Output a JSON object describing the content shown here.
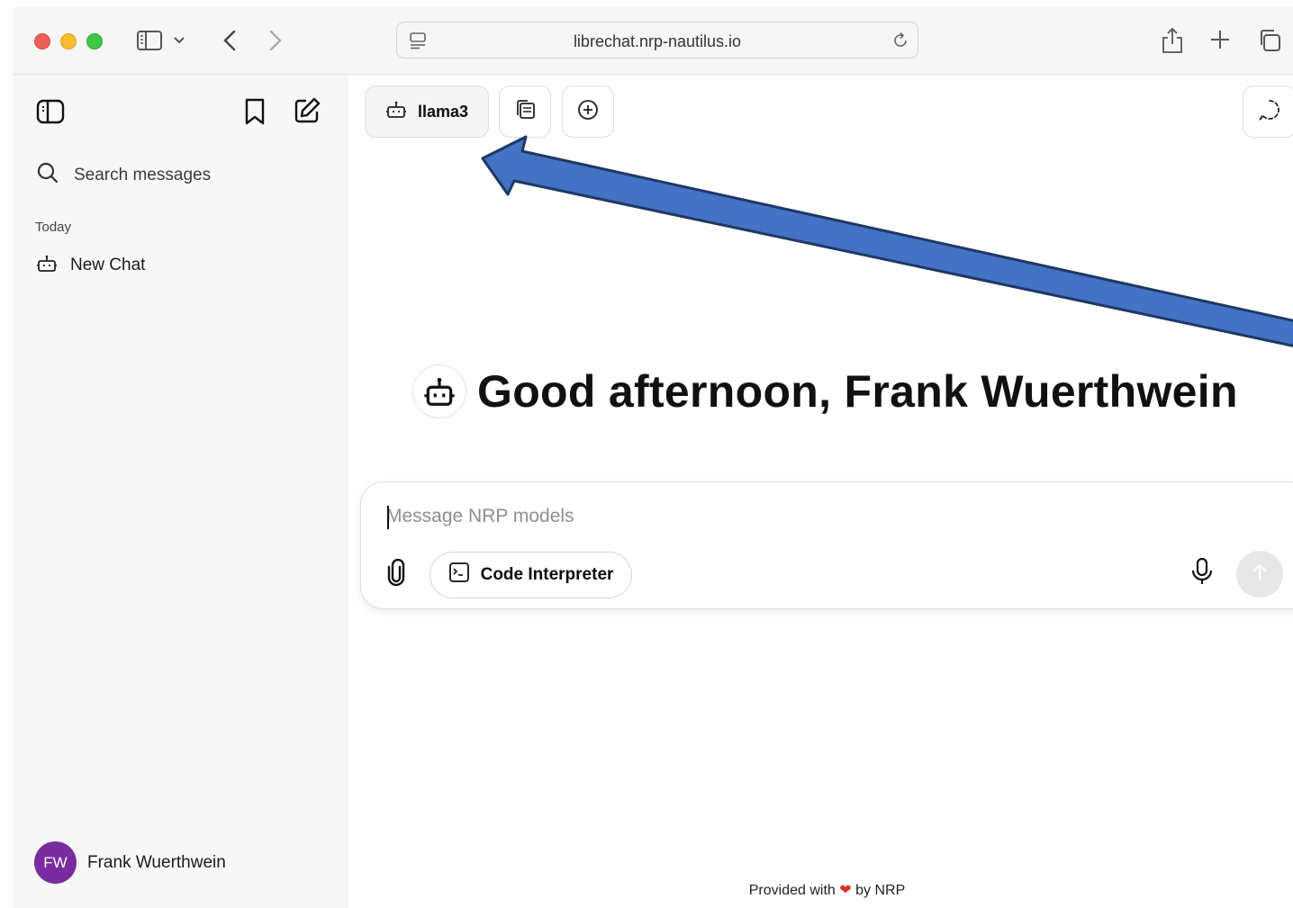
{
  "browser": {
    "url": "librechat.nrp-nautilus.io"
  },
  "sidebar": {
    "search_label": "Search messages",
    "section_today": "Today",
    "chats": [
      {
        "title": "New Chat"
      }
    ],
    "user": {
      "initials": "FW",
      "name": "Frank Wuerthwein",
      "avatar_color": "#7a2b9f"
    }
  },
  "header": {
    "model_label": "llama3"
  },
  "main": {
    "greeting": "Good afternoon, Frank Wuerthwein",
    "composer": {
      "placeholder": "Message NRP models",
      "tool_label": "Code Interpreter"
    },
    "footer": {
      "prefix": "Provided with",
      "suffix": "by NRP"
    }
  },
  "annotation": {
    "arrow_color": "#4472c4"
  }
}
